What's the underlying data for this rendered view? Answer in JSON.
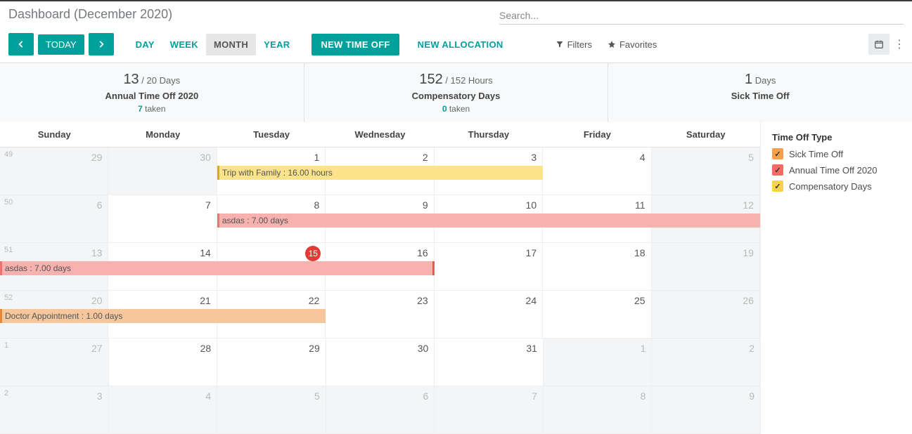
{
  "header": {
    "title": "Dashboard (December 2020)",
    "search_placeholder": "Search..."
  },
  "toolbar": {
    "today": "TODAY",
    "views": {
      "day": "DAY",
      "week": "WEEK",
      "month": "MONTH",
      "year": "YEAR"
    },
    "new_timeoff": "NEW TIME OFF",
    "new_allocation": "NEW ALLOCATION",
    "filters": "Filters",
    "favorites": "Favorites"
  },
  "summary": [
    {
      "big": "13",
      "rest": " / 20 Days",
      "title": "Annual Time Off 2020",
      "sub_val": "7",
      "sub_rest": " taken"
    },
    {
      "big": "152",
      "rest": " / 152 Hours",
      "title": "Compensatory Days",
      "sub_val": "0",
      "sub_rest": " taken"
    },
    {
      "big": "1",
      "rest": " Days",
      "title": "Sick Time Off",
      "sub_val": "",
      "sub_rest": ""
    }
  ],
  "days_of_week": [
    "Sunday",
    "Monday",
    "Tuesday",
    "Wednesday",
    "Thursday",
    "Friday",
    "Saturday"
  ],
  "weeks": [
    {
      "wk": "49",
      "cells": [
        {
          "n": "29",
          "other": true
        },
        {
          "n": "30",
          "other": true
        },
        {
          "n": "1"
        },
        {
          "n": "2"
        },
        {
          "n": "3"
        },
        {
          "n": "4"
        },
        {
          "n": "5",
          "other": true
        }
      ]
    },
    {
      "wk": "50",
      "cells": [
        {
          "n": "6",
          "other": true
        },
        {
          "n": "7"
        },
        {
          "n": "8"
        },
        {
          "n": "9"
        },
        {
          "n": "10"
        },
        {
          "n": "11"
        },
        {
          "n": "12",
          "other": true
        }
      ]
    },
    {
      "wk": "51",
      "cells": [
        {
          "n": "13",
          "other": true
        },
        {
          "n": "14"
        },
        {
          "n": "15",
          "today": true
        },
        {
          "n": "16"
        },
        {
          "n": "17"
        },
        {
          "n": "18"
        },
        {
          "n": "19",
          "other": true
        }
      ]
    },
    {
      "wk": "52",
      "cells": [
        {
          "n": "20",
          "other": true
        },
        {
          "n": "21"
        },
        {
          "n": "22"
        },
        {
          "n": "23"
        },
        {
          "n": "24"
        },
        {
          "n": "25"
        },
        {
          "n": "26",
          "other": true
        }
      ]
    },
    {
      "wk": "1",
      "cells": [
        {
          "n": "27",
          "other": true
        },
        {
          "n": "28"
        },
        {
          "n": "29"
        },
        {
          "n": "30"
        },
        {
          "n": "31"
        },
        {
          "n": "1",
          "other": true
        },
        {
          "n": "2",
          "other": true
        }
      ]
    },
    {
      "wk": "2",
      "cells": [
        {
          "n": "3",
          "other": true
        },
        {
          "n": "4",
          "other": true
        },
        {
          "n": "5",
          "other": true
        },
        {
          "n": "6",
          "other": true
        },
        {
          "n": "7",
          "other": true
        },
        {
          "n": "8",
          "other": true
        },
        {
          "n": "9",
          "other": true
        }
      ]
    }
  ],
  "events": {
    "trip": "Trip with Family : 16.00 hours",
    "asdas": "asdas : 7.00 days",
    "doctor": "Doctor Appointment : 1.00 days"
  },
  "legend": {
    "title": "Time Off Type",
    "items": [
      "Sick Time Off",
      "Annual Time Off 2020",
      "Compensatory Days"
    ]
  }
}
